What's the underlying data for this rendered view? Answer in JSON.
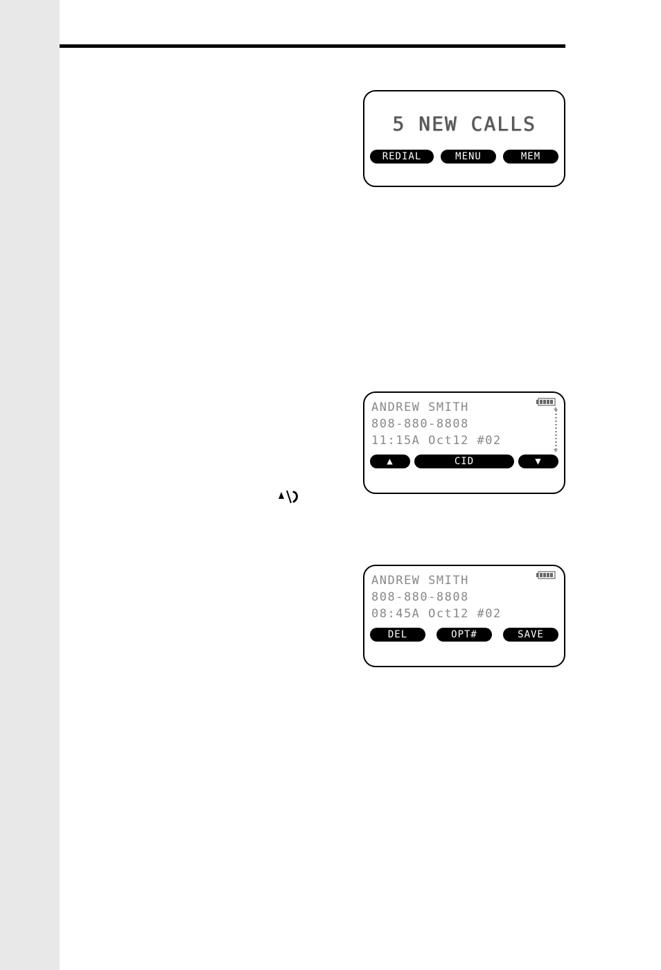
{
  "lcd1": {
    "big_text": "5 NEW CALLS",
    "softkeys": {
      "left": "REDIAL",
      "mid": "MENU",
      "right": "MEM"
    }
  },
  "lcd2": {
    "line1": "ANDREW SMITH",
    "line2": "808-880-8808",
    "line3": "11:15A Oct12 #02",
    "softkeys": {
      "left": "▲",
      "mid": "CID",
      "right": "▼"
    },
    "battery_icon": "battery-icon",
    "scroll_indicator": true
  },
  "lcd3": {
    "line1": "ANDREW SMITH",
    "line2": "808-880-8808",
    "line3": "08:45A Oct12 #02",
    "softkeys": {
      "left": "DEL",
      "mid": "OPT#",
      "right": "SAVE"
    },
    "battery_icon": "battery-icon"
  },
  "jog_icon": "jog-dial-icon"
}
